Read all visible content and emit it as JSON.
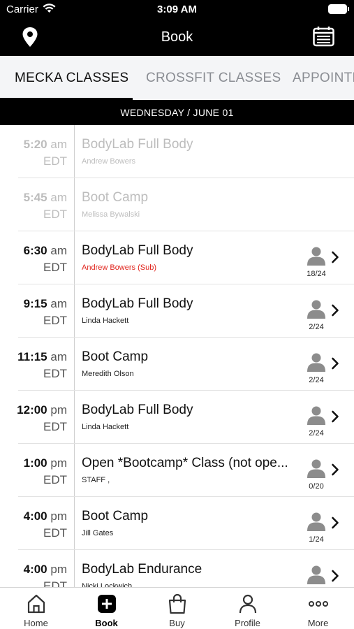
{
  "status_bar": {
    "carrier": "Carrier",
    "time": "3:09 AM"
  },
  "nav": {
    "title": "Book",
    "left_icon": "location-pin-icon",
    "right_icon": "calendar-icon"
  },
  "tabs": [
    {
      "label": "MECKA CLASSES",
      "active": true
    },
    {
      "label": "CROSSFIT CLASSES",
      "active": false
    },
    {
      "label": "APPOINTMENTS",
      "active": false
    }
  ],
  "date_header": "WEDNESDAY / JUNE 01",
  "classes": [
    {
      "time": "5:20",
      "ampm": "am",
      "zone": "EDT",
      "name": "BodyLab Full Body",
      "instructor": "Andrew Bowers",
      "past": true
    },
    {
      "time": "5:45",
      "ampm": "am",
      "zone": "EDT",
      "name": "Boot Camp",
      "instructor": "Melissa Bywalski",
      "past": true
    },
    {
      "time": "6:30",
      "ampm": "am",
      "zone": "EDT",
      "name": "BodyLab Full Body",
      "instructor": "Andrew Bowers (Sub)",
      "sub": true,
      "count": "18/24"
    },
    {
      "time": "9:15",
      "ampm": "am",
      "zone": "EDT",
      "name": "BodyLab Full Body",
      "instructor": "Linda Hackett",
      "count": "2/24"
    },
    {
      "time": "11:15",
      "ampm": "am",
      "zone": "EDT",
      "name": "Boot Camp",
      "instructor": "Meredith Olson",
      "count": "2/24"
    },
    {
      "time": "12:00",
      "ampm": "pm",
      "zone": "EDT",
      "name": "BodyLab Full Body",
      "instructor": "Linda Hackett",
      "count": "2/24"
    },
    {
      "time": "1:00",
      "ampm": "pm",
      "zone": "EDT",
      "name": "Open *Bootcamp* Class (not ope...",
      "instructor": "STAFF ,",
      "count": "0/20"
    },
    {
      "time": "4:00",
      "ampm": "pm",
      "zone": "EDT",
      "name": "Boot Camp",
      "instructor": "Jill Gates",
      "count": "1/24"
    },
    {
      "time": "4:00",
      "ampm": "pm",
      "zone": "EDT",
      "name": "BodyLab Endurance",
      "instructor": "Nicki Lockwich",
      "count": ""
    }
  ],
  "tab_bar": [
    {
      "label": "Home",
      "icon": "home-icon"
    },
    {
      "label": "Book",
      "icon": "plus-square-icon",
      "active": true
    },
    {
      "label": "Buy",
      "icon": "shopping-bag-icon"
    },
    {
      "label": "Profile",
      "icon": "person-icon"
    },
    {
      "label": "More",
      "icon": "more-dots-icon"
    }
  ],
  "colors": {
    "header_bg": "#000000",
    "tab_bg": "#f4f5f7",
    "sub_red": "#e0231b",
    "past_gray": "#bdbdbd"
  }
}
